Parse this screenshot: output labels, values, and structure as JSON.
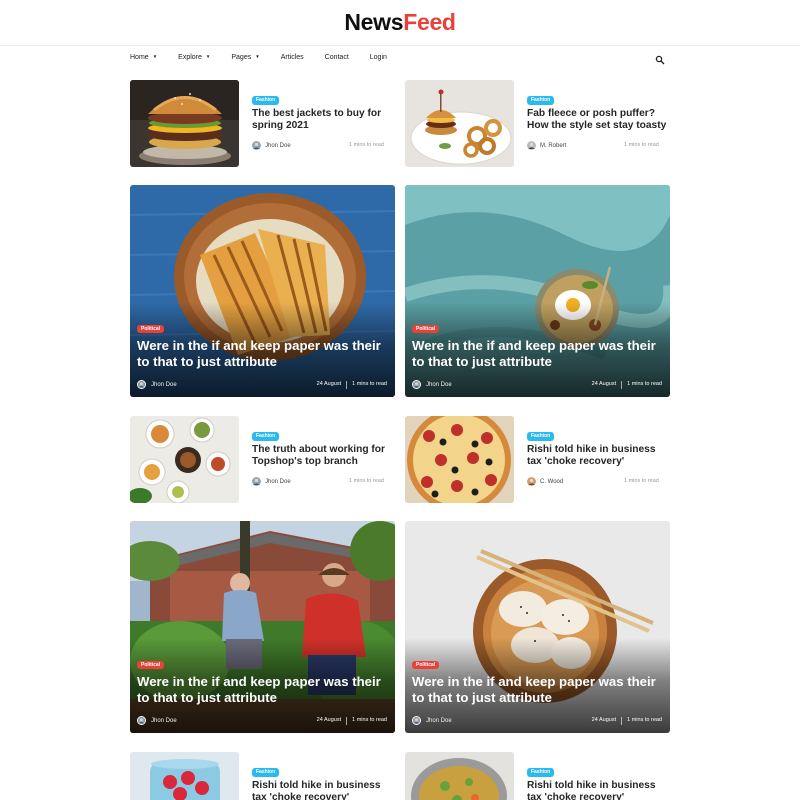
{
  "site": {
    "logo_main": "News",
    "logo_accent": "Feed",
    "accent_color": "#e8413a"
  },
  "nav": {
    "items": [
      {
        "label": "Home",
        "dropdown": true
      },
      {
        "label": "Explore",
        "dropdown": true
      },
      {
        "label": "Pages",
        "dropdown": true
      },
      {
        "label": "Articles",
        "dropdown": false
      },
      {
        "label": "Contact",
        "dropdown": false
      },
      {
        "label": "Login",
        "dropdown": false
      }
    ],
    "search_icon": "search-icon"
  },
  "small_cards": [
    {
      "category": "Fashion",
      "title": "The best jackets to buy for spring 2021",
      "author": "Jhon Doe",
      "read_time": "1 mins to read",
      "image": "burger-photo"
    },
    {
      "category": "Fashion",
      "title": "Fab fleece or posh puffer? How the style set stay toasty",
      "author": "M. Robert",
      "read_time": "1 mins to read",
      "image": "burger-onion-rings-photo"
    },
    {
      "category": "Fashion",
      "title": "The truth about working for Topshop's top branch",
      "author": "Jhon Doe",
      "read_time": "1 mins to read",
      "image": "food-bowls-photo"
    },
    {
      "category": "Fashion",
      "title": "Rishi told hike in business tax 'choke recovery'",
      "author": "C. Wood",
      "read_time": "1 mins to read",
      "image": "pizza-photo"
    },
    {
      "category": "Fashion",
      "title": "Rishi told hike in business tax 'choke recovery'",
      "author": "",
      "read_time": "",
      "image": "berries-jar-photo"
    },
    {
      "category": "Fashion",
      "title": "Rishi told hike in business tax 'choke recovery'",
      "author": "",
      "read_time": "",
      "image": "soup-pot-photo"
    }
  ],
  "big_cards": [
    {
      "category": "Political",
      "title": "Were in the if and keep paper was their to that to just attribute",
      "author": "Jhon Doe",
      "date": "24 August",
      "read_time": "1 mins to read",
      "image": "grilled-sandwich-photo"
    },
    {
      "category": "Political",
      "title": "Were in the if and keep paper was their to that to just attribute",
      "author": "Jhon Doe",
      "date": "24 August",
      "read_time": "1 mins to read",
      "image": "egg-bowl-photo"
    },
    {
      "category": "Political",
      "title": "Were in the if and keep paper was their to that to just attribute",
      "author": "Jhon Doe",
      "date": "24 August",
      "read_time": "1 mins to read",
      "image": "gardening-photo"
    },
    {
      "category": "Political",
      "title": "Were in the if and keep paper was their to that to just attribute",
      "author": "Jhon Doe",
      "date": "24 August",
      "read_time": "1 mins to read",
      "image": "dumplings-photo"
    }
  ]
}
